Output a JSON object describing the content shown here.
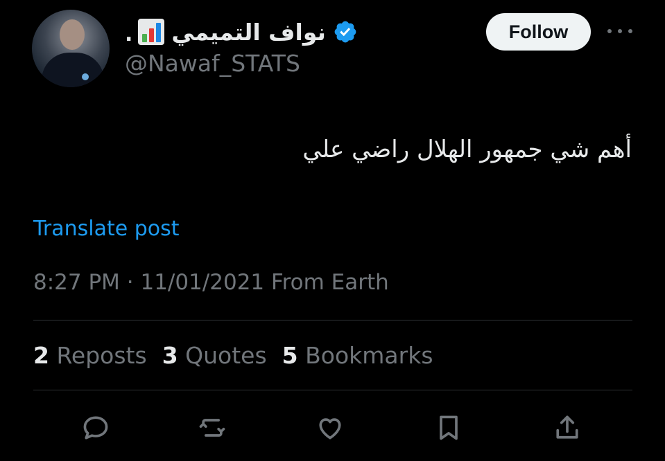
{
  "author": {
    "display_name": "نواف التميمي",
    "name_suffix": ".",
    "handle": "@Nawaf_STATS"
  },
  "follow_label": "Follow",
  "post": {
    "text": "أهم شي جمهور الهلال راضي علي",
    "translate_label": "Translate post",
    "meta": "8:27 PM · 11/01/2021 From Earth"
  },
  "stats": {
    "reposts_count": "2",
    "reposts_label": "Reposts",
    "quotes_count": "3",
    "quotes_label": "Quotes",
    "bookmarks_count": "5",
    "bookmarks_label": "Bookmarks"
  },
  "icons": {
    "verified": "verified-badge-icon",
    "stats_emoji": "bar-chart-icon",
    "reply": "reply-icon",
    "repost": "repost-icon",
    "like": "heart-icon",
    "bookmark": "bookmark-icon",
    "share": "share-icon",
    "more": "more-icon"
  },
  "colors": {
    "background": "#000000",
    "text": "#e7e9ea",
    "secondary": "#71767b",
    "accent": "#1d9bf0",
    "divider": "#2f3336"
  }
}
